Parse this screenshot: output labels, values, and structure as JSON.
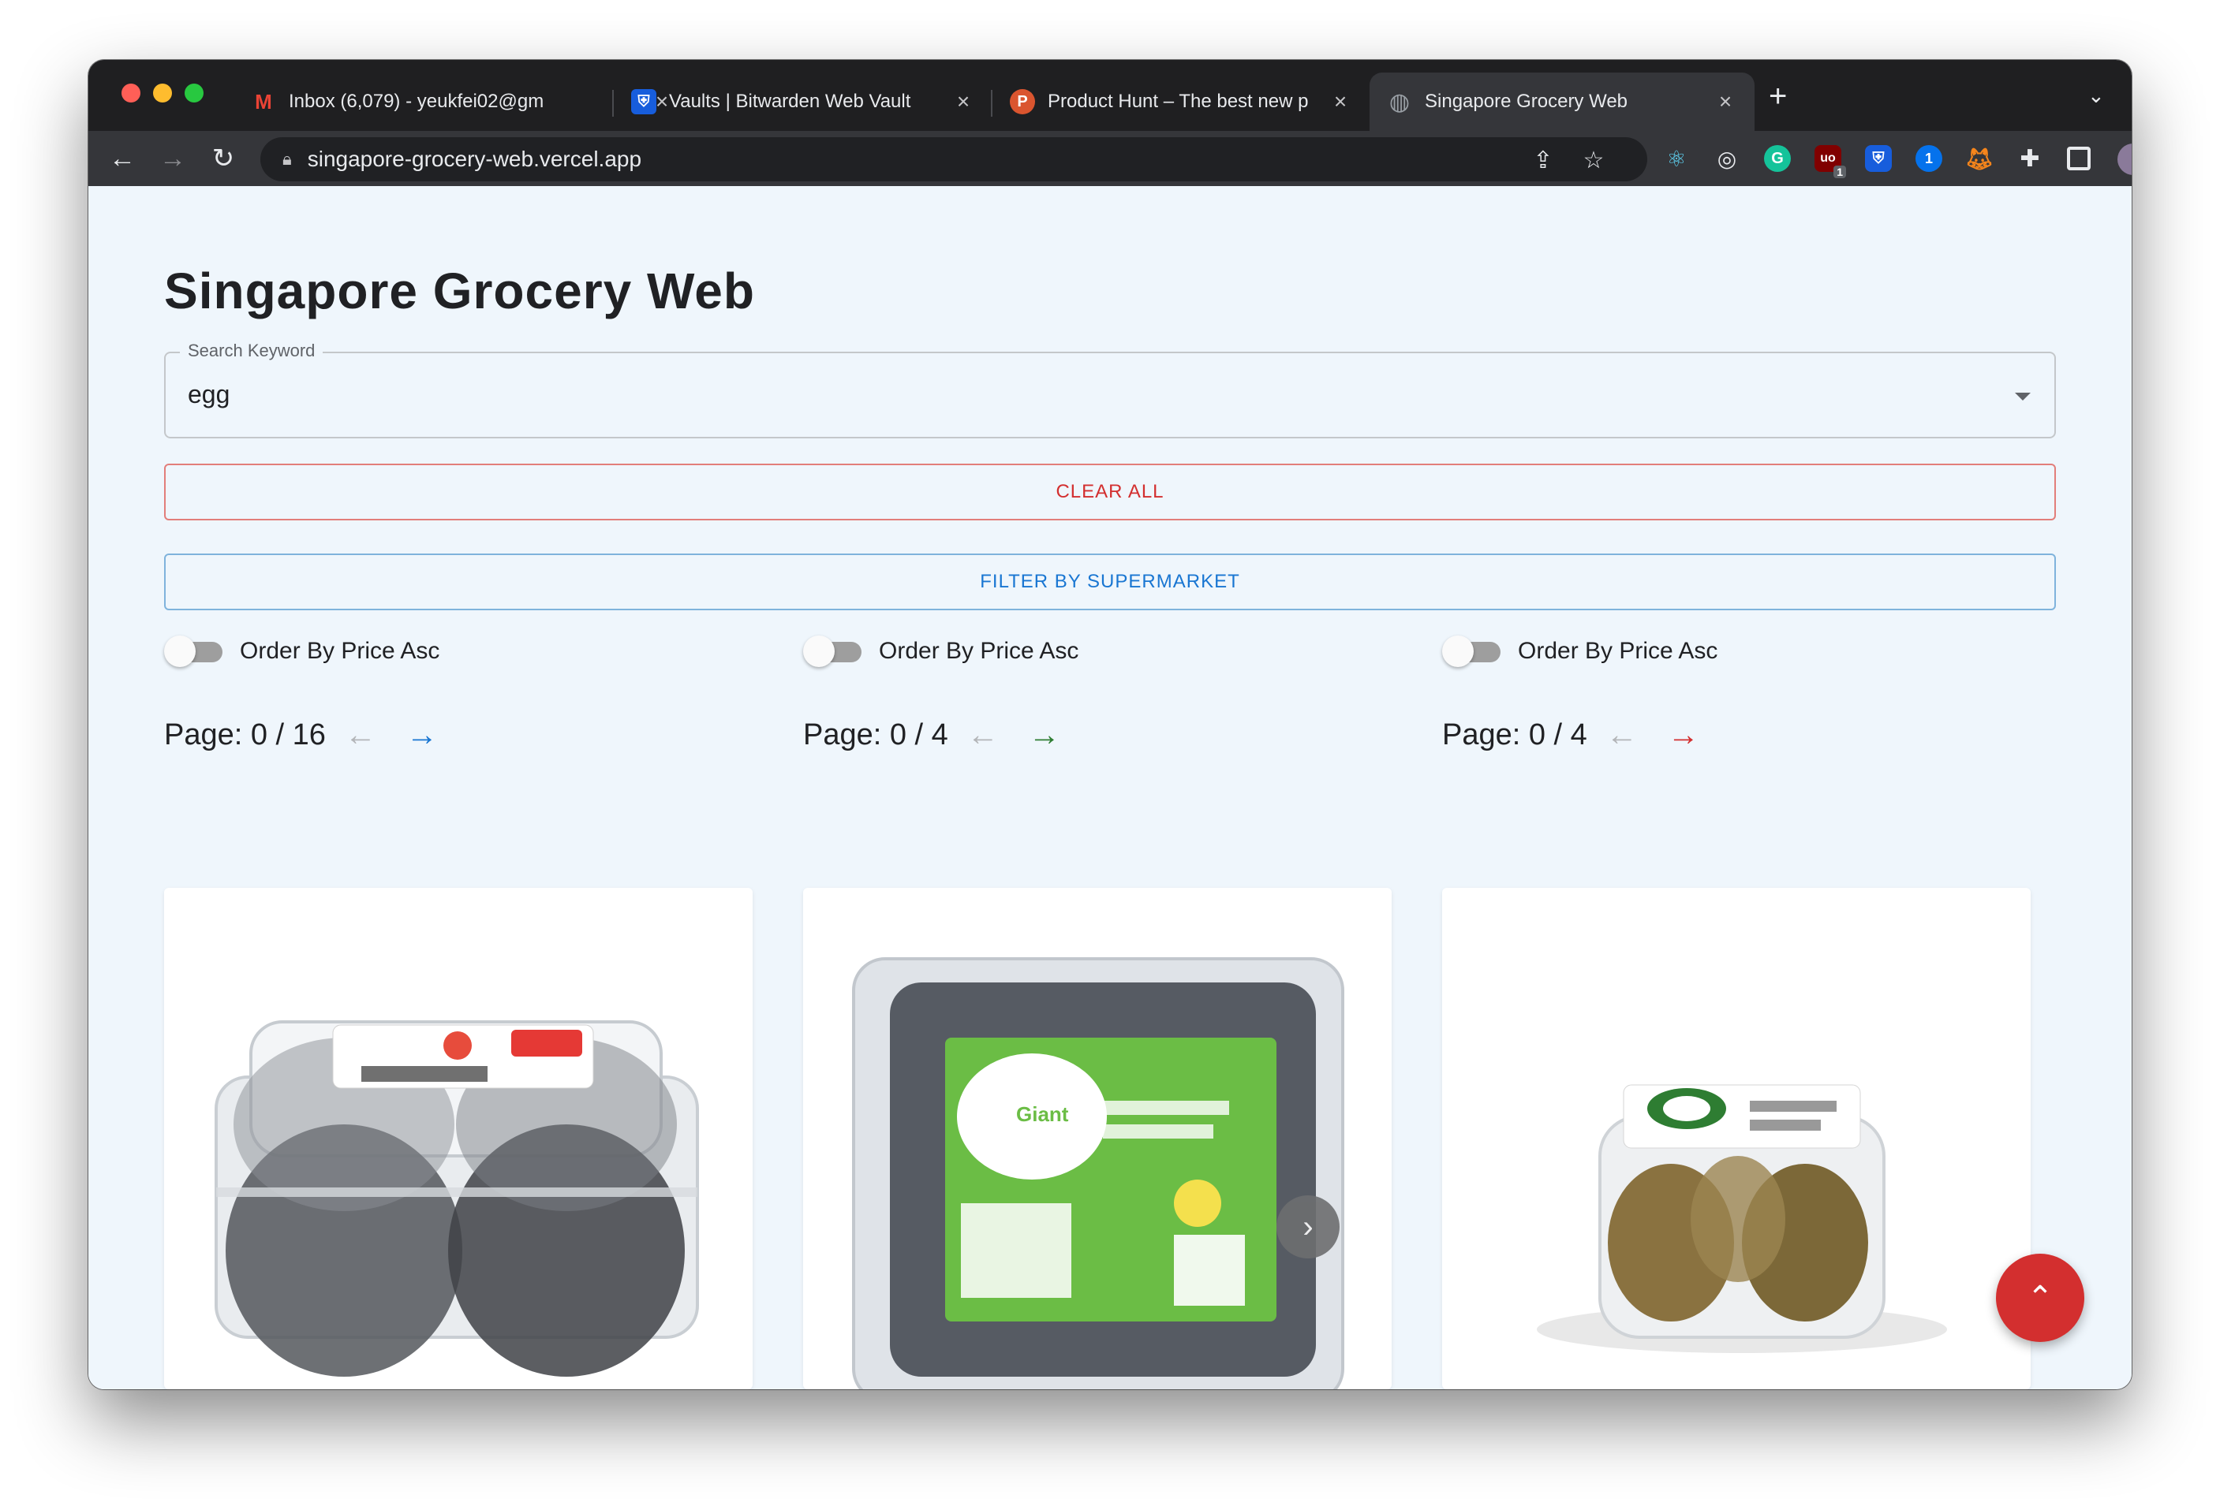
{
  "browser": {
    "tabs": [
      {
        "title": "Inbox (6,079) - yeukfei02@gm",
        "favicon": "gmail-icon",
        "favicon_glyph": "M",
        "favicon_color": "#ea4335"
      },
      {
        "title": "Vaults | Bitwarden Web Vault",
        "favicon": "bitwarden-icon",
        "favicon_glyph": "⛨",
        "favicon_color": "#175ddc"
      },
      {
        "title": "Product Hunt – The best new p",
        "favicon": "producthunt-icon",
        "favicon_glyph": "P",
        "favicon_color": "#da552f"
      },
      {
        "title": "Singapore Grocery Web",
        "favicon": "globe-icon",
        "favicon_glyph": "◍",
        "favicon_color": "#5f6368",
        "active": true
      }
    ],
    "new_tab": "+",
    "address": "singapore-grocery-web.vercel.app",
    "extension_badge": "1"
  },
  "page": {
    "title": "Singapore Grocery Web",
    "search": {
      "label": "Search Keyword",
      "value": "egg"
    },
    "clear_all": "CLEAR ALL",
    "filter_supermarket": "FILTER BY SUPERMARKET",
    "columns": [
      {
        "toggle_label": "Order By Price Asc",
        "toggle_on": false,
        "page_text": "Page: 0 / 16",
        "accent": "#1976d2"
      },
      {
        "toggle_label": "Order By Price Asc",
        "toggle_on": false,
        "page_text": "Page: 0 / 4",
        "accent": "#2e7d32"
      },
      {
        "toggle_label": "Order By Price Asc",
        "toggle_on": false,
        "page_text": "Page: 0 / 4",
        "accent": "#d32f2f"
      }
    ],
    "products": [
      {
        "image": "salted-eggs-clear-pack"
      },
      {
        "image": "giant-salted-duck-eggs"
      },
      {
        "image": "century-eggs-pack"
      }
    ]
  },
  "colors": {
    "danger": "#d32f2f",
    "primary": "#1976d2",
    "success": "#2e7d32",
    "page_bg": "#eff6fc"
  }
}
